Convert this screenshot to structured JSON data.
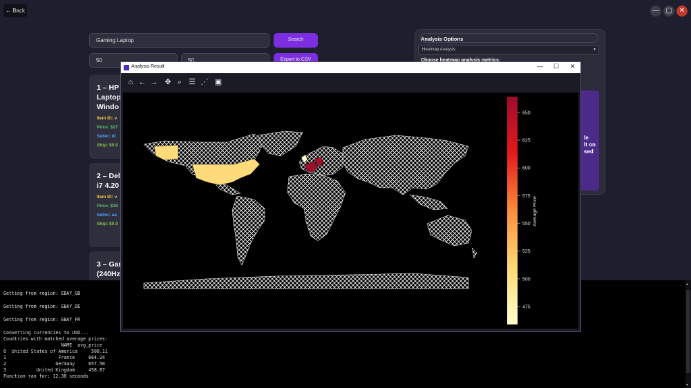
{
  "top": {
    "back_label": "← Back",
    "min": "—",
    "max": "▢",
    "close": "✕"
  },
  "search": {
    "query": "Gaming Laptop",
    "search_label": "Search",
    "min_value": "50",
    "max_value": "50",
    "export_label": "Export to CSV"
  },
  "cards": [
    {
      "title1": "1 – HP",
      "title2": "Laptop",
      "title3": "Windo",
      "item": "Item ID: v",
      "price": "Price: $27",
      "seller": "Seller: di",
      "ship": "Ship: $0.0"
    },
    {
      "title1": "2 – Del",
      "title2": "i7 4.20",
      "title3": "",
      "item": "Item ID: v",
      "price": "Price: $39",
      "seller": "Seller: aa",
      "ship": "Ship: $0.0"
    },
    {
      "title1": "3 – Gar",
      "title2": "(240Hz",
      "title3": "",
      "item": "",
      "price": "",
      "seller": "",
      "ship": ""
    }
  ],
  "panel": {
    "heading": "Analysis Options",
    "dropdown": "Heatmap Analysis",
    "metrics_label": "Choose heatmap analysis metrics:",
    "peek": [
      "le",
      "lt on",
      "sed"
    ]
  },
  "window": {
    "title": "Analysis Result",
    "min": "—",
    "max": "☐",
    "close": "✕"
  },
  "toolbar": [
    "home-icon",
    "back-arrow-icon",
    "forward-arrow-icon",
    "pan-icon",
    "zoom-icon",
    "configure-icon",
    "axes-icon",
    "save-icon"
  ],
  "chart_data": {
    "type": "heatmap",
    "colorbar_label": "Average Price",
    "colorbar_ticks": [
      475,
      500,
      525,
      550,
      575,
      600,
      625,
      650
    ],
    "range": [
      458.87,
      664.24
    ],
    "regions": [
      {
        "name": "United States of America",
        "value": 508.11
      },
      {
        "name": "France",
        "value": 664.24
      },
      {
        "name": "Germany",
        "value": 657.5
      },
      {
        "name": "United Kingdom",
        "value": 458.87
      }
    ]
  },
  "terminal": {
    "lines": [
      "Getting from region: EBAY_GB",
      "",
      "Getting from region: EBAY_DE",
      "",
      "Getting from region: EBAY_FR",
      "",
      "Converting currencies to USD...",
      "Countries with matched average prices:",
      "                     NAME  avg_price",
      "0  United States of America     508.11",
      "1                   France     664.24",
      "2                  Germany     657.50",
      "3           United Kingdom     458.87",
      "Function ran for: 12.38 seconds"
    ]
  }
}
